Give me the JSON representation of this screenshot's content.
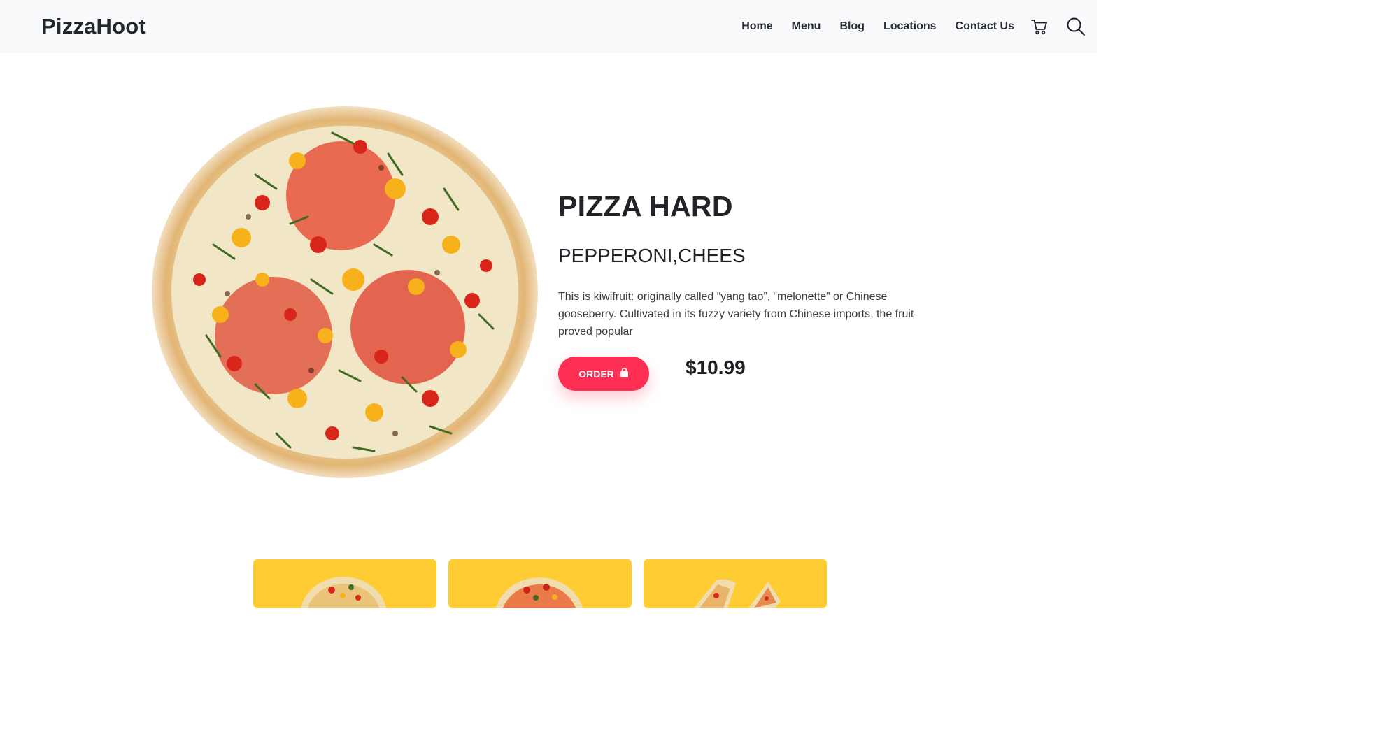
{
  "brand": {
    "name": "PizzaHoot"
  },
  "nav": {
    "items": [
      "Home",
      "Menu",
      "Blog",
      "Locations",
      "Contact Us"
    ],
    "cart_icon": "cart-icon",
    "search_icon": "search-icon"
  },
  "hero": {
    "title": "PIZZA HARD",
    "subtitle": "PEPPERONI,CHEES",
    "description": "This is kiwifruit: originally called “yang tao”, “melonette” or Chinese gooseberry. Cultivated in its fuzzy variety from Chinese imports, the fruit proved popular",
    "order_label": "ORDER",
    "order_icon": "shopping-bag-icon",
    "price": "$10.99",
    "image": "pizza-image"
  },
  "cards": [
    {
      "image": "pizza-thumbnail"
    },
    {
      "image": "pizza-thumbnail"
    },
    {
      "image": "pizza-slices-thumbnail"
    }
  ],
  "colors": {
    "accent": "#ff2e54",
    "card_background": "#ffcc33",
    "header_background": "#f8f9fa",
    "text": "#212329"
  }
}
